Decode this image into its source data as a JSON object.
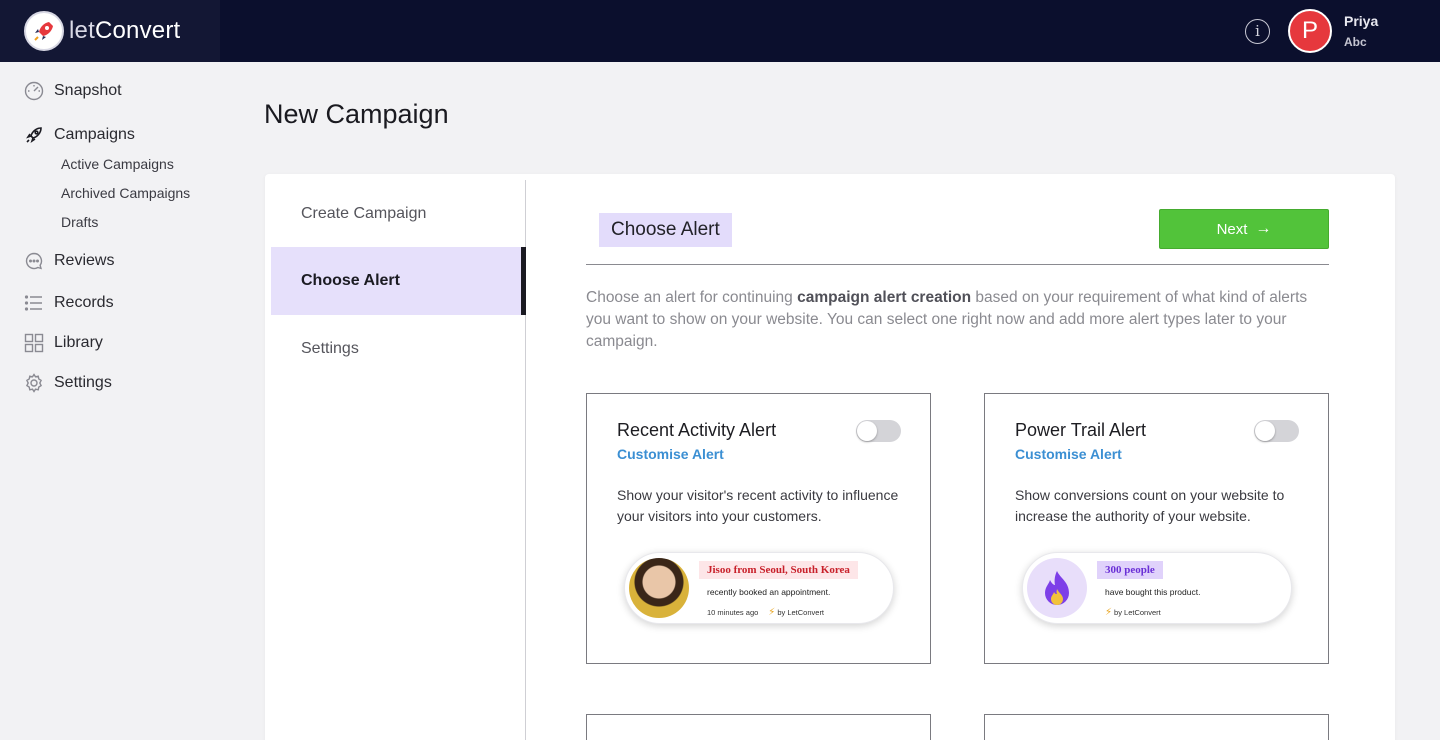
{
  "brand": {
    "name_light": "let",
    "name_bold": "Convert"
  },
  "header": {
    "user": {
      "initial": "P",
      "name": "Priya",
      "org": "Abc"
    }
  },
  "sidebar": {
    "items": [
      {
        "label": "Snapshot",
        "icon": "gauge-icon"
      },
      {
        "label": "Campaigns",
        "icon": "rocket-icon",
        "active": true
      },
      {
        "label": "Reviews",
        "icon": "chat-bubble-icon"
      },
      {
        "label": "Records",
        "icon": "list-icon"
      },
      {
        "label": "Library",
        "icon": "grid-icon"
      },
      {
        "label": "Settings",
        "icon": "gear-icon"
      }
    ],
    "campaign_sub": [
      "Active Campaigns",
      "Archived Campaigns",
      "Drafts"
    ]
  },
  "page": {
    "title": "New Campaign"
  },
  "steps": [
    {
      "label": "Create Campaign"
    },
    {
      "label": "Choose Alert",
      "active": true
    },
    {
      "label": "Settings"
    }
  ],
  "content": {
    "section_title": "Choose Alert",
    "next_label": "Next",
    "description_pre": "Choose an alert for continuing ",
    "description_bold": "campaign alert creation",
    "description_post": " based on your requirement of what kind of alerts you want to show on your website. You can select one right now and add more alert types later to your campaign."
  },
  "cards": [
    {
      "title": "Recent Activity Alert",
      "customise": "Customise Alert",
      "enabled": false,
      "description": "Show your visitor's recent activity to influence your visitors into your customers.",
      "preview": {
        "headline": "Jisoo from Seoul, South Korea",
        "line": "recently booked an appointment.",
        "time": "10 minutes ago",
        "by": "by LetConvert"
      }
    },
    {
      "title": "Power Trail Alert",
      "customise": "Customise Alert",
      "enabled": false,
      "description": "Show conversions count on your website to increase the authority of your website.",
      "preview": {
        "headline": "300 people",
        "line": "have bought this product.",
        "by": "by LetConvert"
      }
    }
  ],
  "colors": {
    "topbar": "#0b0f2d",
    "accent_purple": "#e3dcfb",
    "next_green": "#52c33a",
    "link_blue": "#3b8fd3",
    "avatar_red": "#e6383d"
  }
}
